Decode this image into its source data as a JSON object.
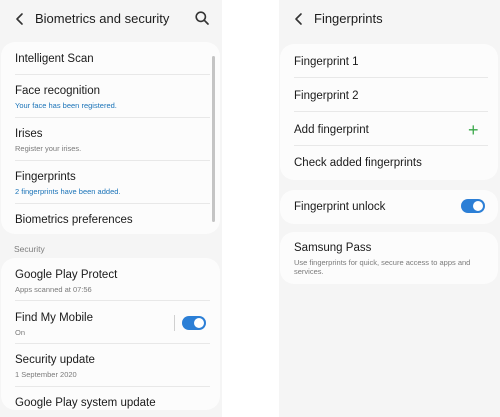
{
  "left": {
    "header": {
      "title": "Biometrics and security"
    },
    "items": [
      {
        "label": "Intelligent Scan"
      },
      {
        "label": "Face recognition",
        "sub": "Your face has been registered."
      },
      {
        "label": "Irises",
        "sub": "Register your irises."
      },
      {
        "label": "Fingerprints",
        "sub": "2 fingerprints have been added."
      },
      {
        "label": "Biometrics preferences"
      }
    ],
    "section_label": "Security",
    "security_items": [
      {
        "label": "Google Play Protect",
        "sub": "Apps scanned at 07:56"
      },
      {
        "label": "Find My Mobile",
        "sub": "On",
        "toggle": true
      },
      {
        "label": "Security update",
        "sub": "1 September 2020"
      },
      {
        "label": "Google Play system update"
      }
    ]
  },
  "right": {
    "header": {
      "title": "Fingerprints"
    },
    "items": [
      {
        "label": "Fingerprint 1"
      },
      {
        "label": "Fingerprint 2"
      },
      {
        "label": "Add fingerprint"
      },
      {
        "label": "Check added fingerprints"
      }
    ],
    "unlock": {
      "label": "Fingerprint unlock",
      "toggle": true
    },
    "pass": {
      "label": "Samsung Pass",
      "sub": "Use fingerprints for quick, secure access to apps and services."
    }
  },
  "colors": {
    "accent": "#2c7fd6",
    "link": "#1a73b8",
    "plus": "#3aa84a",
    "background": "#f5f5f5"
  }
}
